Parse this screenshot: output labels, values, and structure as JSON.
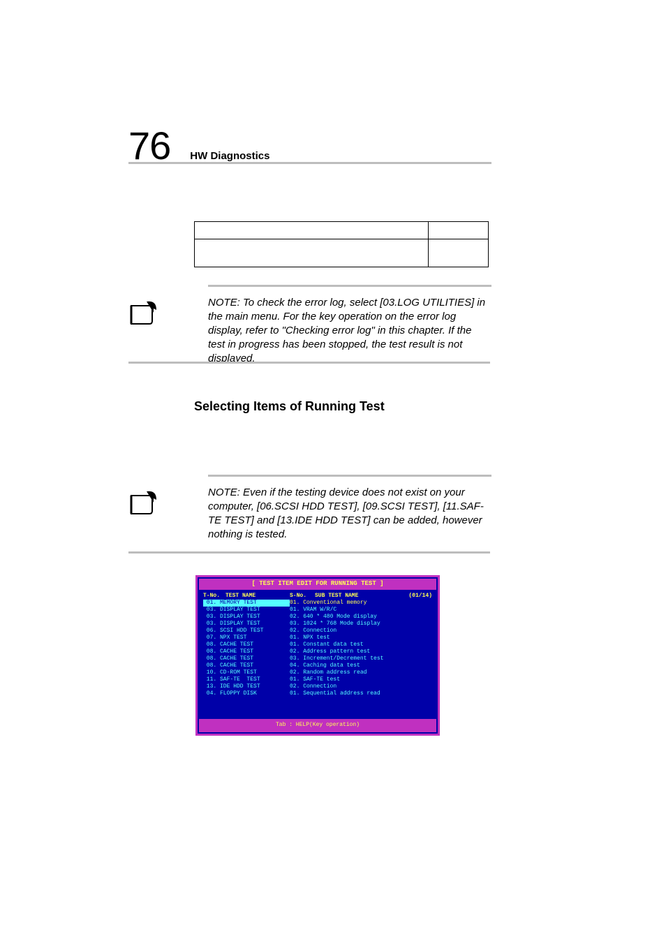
{
  "header": {
    "page_number": "76",
    "section": "HW Diagnostics"
  },
  "note1": {
    "text": "NOTE: To check the error log, select [03.LOG UTILITIES] in the main menu. For the key operation on the error log display, refer to \"Checking error log\" in this chapter. If the test in progress has been stopped, the test result is not displayed."
  },
  "heading2": "Selecting Items of Running Test",
  "note2": {
    "text": "NOTE: Even if the testing device does not exist on your computer, [06.SCSI HDD TEST], [09.SCSI TEST], [11.SAF-TE TEST] and [13.IDE HDD TEST] can be added, however nothing is tested."
  },
  "console": {
    "title": "[ TEST ITEM EDIT FOR RUNNING TEST ]",
    "columns": {
      "tno": "T-No.",
      "tname": "TEST NAME",
      "sno": "S-No.",
      "sname": "SUB TEST NAME",
      "count": "(01/14)"
    },
    "rows": [
      {
        "t": "01. MEMORY TEST",
        "s": "01. Conventional memory",
        "hl": true
      },
      {
        "t": "03. DISPLAY TEST",
        "s": "01. VRAM W/R/C"
      },
      {
        "t": "03. DISPLAY TEST",
        "s": "02. 640 * 480 Mode display"
      },
      {
        "t": "03. DISPLAY TEST",
        "s": "03. 1024 * 768 Mode display"
      },
      {
        "t": "06. SCSI HDD TEST",
        "s": "02. Connection"
      },
      {
        "t": "07. NPX TEST",
        "s": "01. NPX test"
      },
      {
        "t": "08. CACHE TEST",
        "s": "01. Constant data test"
      },
      {
        "t": "08. CACHE TEST",
        "s": "02. Address pattern test"
      },
      {
        "t": "08. CACHE TEST",
        "s": "03. Increment/Decrement test"
      },
      {
        "t": "08. CACHE TEST",
        "s": "04. Caching data test"
      },
      {
        "t": "10. CD-ROM TEST",
        "s": "02. Random address read"
      },
      {
        "t": "11. SAF-TE  TEST",
        "s": "01. SAF-TE test"
      },
      {
        "t": "13. IDE HDD TEST",
        "s": "02. Connection"
      },
      {
        "t": "04. FLOPPY DISK",
        "s": "01. Sequential address read"
      }
    ],
    "footer": "Tab : HELP(Key operation)"
  }
}
